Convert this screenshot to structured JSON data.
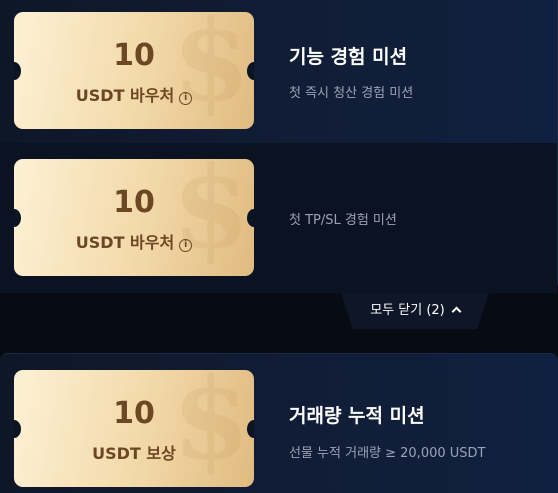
{
  "missions": [
    {
      "voucher_amount": "10",
      "voucher_unit": "USDT 바우처",
      "title": "기능 경험 미션",
      "description": "첫 즉시 청산 경험 미션"
    },
    {
      "voucher_amount": "10",
      "voucher_unit": "USDT 바우처",
      "title": "",
      "description": "첫 TP/SL 경험 미션"
    },
    {
      "voucher_amount": "10",
      "voucher_unit": "USDT 보상",
      "title": "거래량 누적 미션",
      "description": "선물 누적 거래량 ≥ 20,000 USDT"
    }
  ],
  "collapse": {
    "label": "모두 닫기 (2)"
  },
  "icons": {
    "info": "info-icon",
    "chevron": "chevron-up-icon",
    "watermark": "dollar-watermark-icon"
  },
  "colors": {
    "voucher_gold": "#f2d8a8",
    "voucher_text": "#6b4724",
    "background": "#070b14"
  }
}
